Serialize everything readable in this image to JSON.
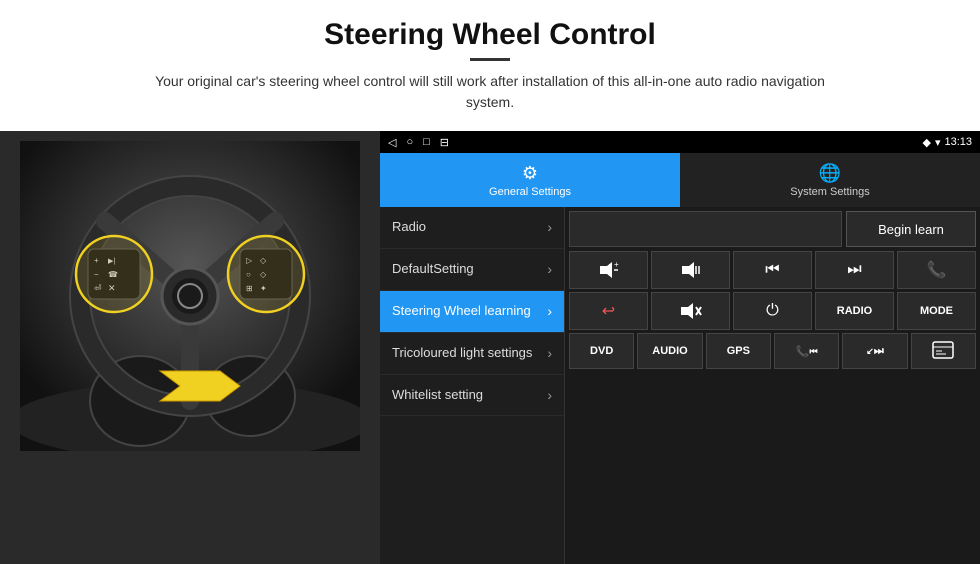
{
  "header": {
    "title": "Steering Wheel Control",
    "subtitle": "Your original car's steering wheel control will still work after installation of this all-in-one auto radio navigation system."
  },
  "status_bar": {
    "icons_left": [
      "◁",
      "○",
      "□",
      "⊟"
    ],
    "location_icon": "♦",
    "wifi_icon": "▾",
    "time": "13:13"
  },
  "tabs": [
    {
      "label": "General Settings",
      "active": true
    },
    {
      "label": "System Settings",
      "active": false
    }
  ],
  "menu_items": [
    {
      "label": "Radio",
      "active": false
    },
    {
      "label": "DefaultSetting",
      "active": false
    },
    {
      "label": "Steering Wheel learning",
      "active": true
    },
    {
      "label": "Tricoloured light settings",
      "active": false
    },
    {
      "label": "Whitelist setting",
      "active": false
    }
  ],
  "begin_learn_label": "Begin learn",
  "control_row1": [
    "🔊+",
    "🔊−",
    "⏮",
    "⏭",
    "📞"
  ],
  "control_row2": [
    "📞↩",
    "🔇",
    "⏻",
    "RADIO",
    "MODE"
  ],
  "bottom_row": [
    "DVD",
    "AUDIO",
    "GPS",
    "📞⏮",
    "↙⏭",
    ""
  ]
}
